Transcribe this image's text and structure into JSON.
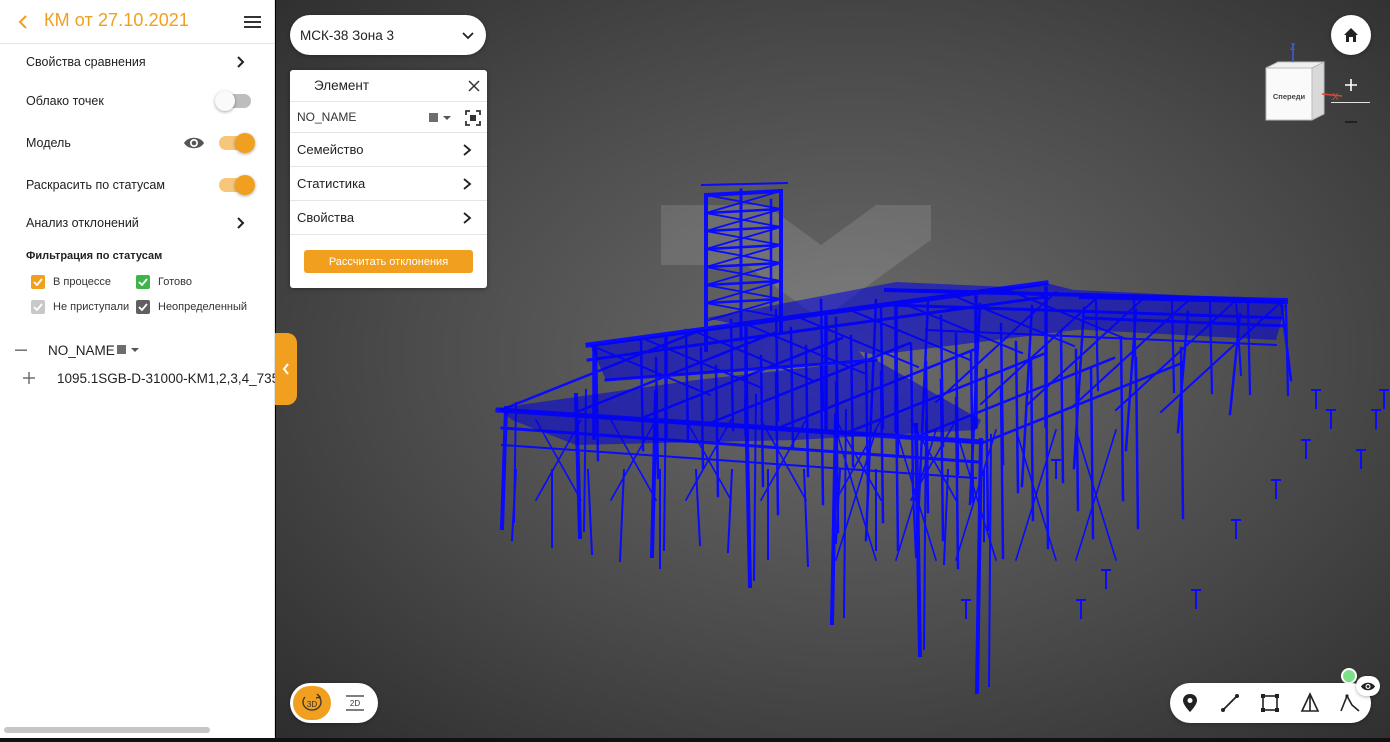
{
  "sidebar": {
    "title": "КМ от 27.10.2021",
    "rows": {
      "compare_props": "Свойства сравнения",
      "point_cloud": "Облако точек",
      "model": "Модель",
      "color_by_status": "Раскрасить по статусам",
      "deviation_analysis": "Анализ отклонений"
    },
    "toggles": {
      "point_cloud": false,
      "model": true,
      "color_by_status": true
    },
    "filter": {
      "title": "Фильтрация по статусам",
      "items": [
        {
          "label": "В процессе",
          "checked": true,
          "color": "#F0A01E"
        },
        {
          "label": "Готово",
          "checked": true,
          "color": "#3CB54A"
        },
        {
          "label": "Не приступали",
          "checked": true,
          "color": "#C8C8C8"
        },
        {
          "label": "Неопределенный",
          "checked": true,
          "color": "#606060"
        }
      ]
    },
    "tree": {
      "root": "NO_NAME",
      "child": "1095.1SGB-D-31000-KM1,2,3,4_735"
    }
  },
  "viewport": {
    "zone": "МСК-38 Зона 3",
    "element_panel": {
      "title": "Элемент",
      "selected": "NO_NAME",
      "rows": [
        "Семейство",
        "Статистика",
        "Свойства"
      ],
      "button": "Рассчитать отклонения"
    },
    "viewcube": {
      "face": "Спереди",
      "axis_z": "Z",
      "axis_x": "X"
    },
    "zoom": {
      "in": "+",
      "out": "−"
    },
    "modes": {
      "three_d": "3D",
      "two_d": "2D",
      "active": "3D"
    },
    "tools": [
      "pin-icon",
      "ruler-icon",
      "box-select-icon",
      "section-icon",
      "profile-icon"
    ]
  },
  "colors": {
    "accent": "#F0A01E",
    "model": "#0000EE",
    "done": "#3CB54A"
  }
}
